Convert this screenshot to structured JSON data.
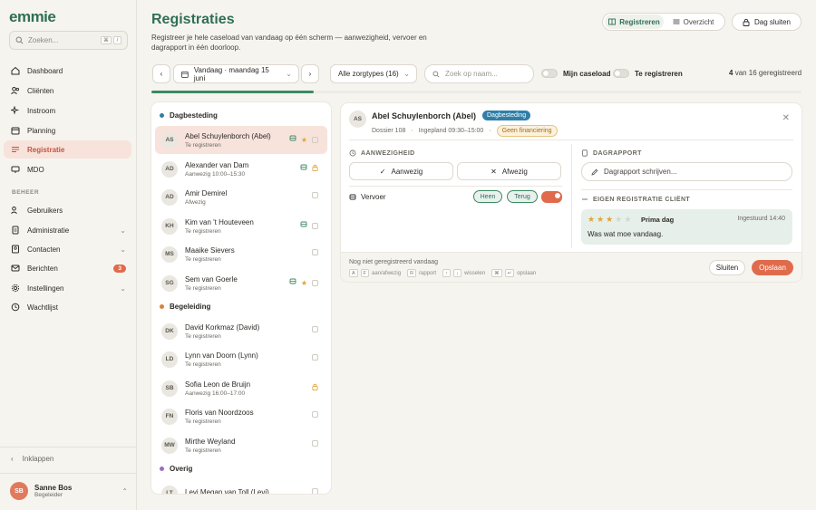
{
  "app": {
    "logo": "emmie"
  },
  "search": {
    "placeholder": "Zoeken...",
    "key1": "⌘",
    "key2": "/"
  },
  "sidebar": {
    "items": [
      {
        "label": "Dashboard"
      },
      {
        "label": "Cliënten"
      },
      {
        "label": "Instroom"
      },
      {
        "label": "Planning"
      },
      {
        "label": "Registratie"
      },
      {
        "label": "MDO"
      }
    ],
    "section_beheer": "BEHEER",
    "beheer_items": [
      {
        "label": "Gebruikers"
      },
      {
        "label": "Administratie"
      },
      {
        "label": "Contacten"
      },
      {
        "label": "Berichten",
        "badge": "3"
      },
      {
        "label": "Instellingen"
      },
      {
        "label": "Wachtlijst"
      }
    ],
    "collapse_label": "Inklappen"
  },
  "user": {
    "initials": "SB",
    "name": "Sanne Bos",
    "role": "Begeleider"
  },
  "header": {
    "title": "Registraties",
    "subtitle": "Registreer je hele caseload van vandaag op één scherm — aanwezigheid, vervoer en dagrapport in één doorloop.",
    "seg_register": "Registreren",
    "seg_overview": "Overzicht",
    "close_day": "Dag sluiten"
  },
  "toolbar": {
    "date_label": "Vandaag · maandag 15 juni",
    "care_filter": "Alle zorgtypes (16)",
    "search_placeholder": "Zoek op naam...",
    "my_caseload": "Mijn caseload",
    "to_register": "Te registreren",
    "count_done": "4",
    "count_text": "van 16 geregistreerd"
  },
  "progress": {
    "fraction": 0.25
  },
  "groups": [
    {
      "label": "Dagbesteding",
      "color": "#2f7fa8"
    },
    {
      "label": "Begeleiding",
      "color": "#d8833d"
    },
    {
      "label": "Overig",
      "color": "#9a6ec0"
    }
  ],
  "clients": [
    {
      "initials": "AS",
      "name": "Abel Schuylenborch (Abel)",
      "status": "Te registreren",
      "bus": true,
      "star": true,
      "lock": false
    },
    {
      "initials": "AD",
      "name": "Alexander van Dam",
      "status": "Aanwezig 10:00–15:30",
      "bus": true,
      "star": false,
      "lock": true
    },
    {
      "initials": "AD",
      "name": "Amir Demirel",
      "status": "Afwezig",
      "bus": false,
      "star": false,
      "lock": false
    },
    {
      "initials": "KH",
      "name": "Kim van 't Houteveen",
      "status": "Te registreren",
      "bus": true,
      "star": false,
      "lock": false
    },
    {
      "initials": "MS",
      "name": "Maaike Sievers",
      "status": "Te registreren",
      "bus": false,
      "star": false,
      "lock": false
    },
    {
      "initials": "SG",
      "name": "Sem van Goerle",
      "status": "Te registreren",
      "bus": true,
      "star": true,
      "lock": false
    },
    {
      "initials": "DK",
      "name": "David Korkmaz (David)",
      "status": "Te registreren",
      "bus": false,
      "star": false,
      "lock": false
    },
    {
      "initials": "LD",
      "name": "Lynn van Doorn (Lynn)",
      "status": "Te registreren",
      "bus": false,
      "star": false,
      "lock": false
    },
    {
      "initials": "SB",
      "name": "Sofia Leon de Bruijn",
      "status": "Aanwezig 16:00–17:00",
      "bus": false,
      "star": false,
      "lock": true
    },
    {
      "initials": "FN",
      "name": "Floris van Noordzoos",
      "status": "Te registreren",
      "bus": false,
      "star": false,
      "lock": false
    },
    {
      "initials": "MW",
      "name": "Mirthe Weyland",
      "status": "Te registreren",
      "bus": false,
      "star": false,
      "lock": false
    },
    {
      "initials": "LT",
      "name": "Levi Megan van Toll (Levi)",
      "status": "",
      "bus": false,
      "star": false,
      "lock": false
    }
  ],
  "detail": {
    "initials": "AS",
    "name": "Abel Schuylenborch (Abel)",
    "tag": "Dagbesteding",
    "dossier": "Dossier 108",
    "planned": "Ingepland 09:30–15:00",
    "funding": "Geen financiering",
    "attendance_head": "AANWEZIGHEID",
    "present": "Aanwezig",
    "absent": "Afwezig",
    "transport": "Vervoer",
    "there": "Heen",
    "back": "Terug",
    "report_head": "DAGRAPPORT",
    "report_placeholder": "Dagrapport schrijven...",
    "own_head": "EIGEN REGISTRATIE CLIËNT",
    "own_rating": 3,
    "own_title": "Prima dag",
    "own_time": "Ingestuurd 14:40",
    "own_text": "Was wat moe vandaag.",
    "footer_hint": "Nog niet geregistreerd vandaag",
    "k_a": "A",
    "k_f": "F",
    "k_af_label": "aan/afwezig",
    "k_r": "R",
    "k_r_label": "rapport",
    "k_up": "↑",
    "k_down": "↓",
    "k_switch_label": "wisselen",
    "k_cmd": "⌘",
    "k_enter": "↵",
    "k_save_label": "opslaan",
    "close": "Sluiten",
    "save": "Opslaan"
  },
  "colors": {
    "accent": "#e06b4c",
    "brand": "#2f6f55",
    "progress": "#3b8a64"
  }
}
